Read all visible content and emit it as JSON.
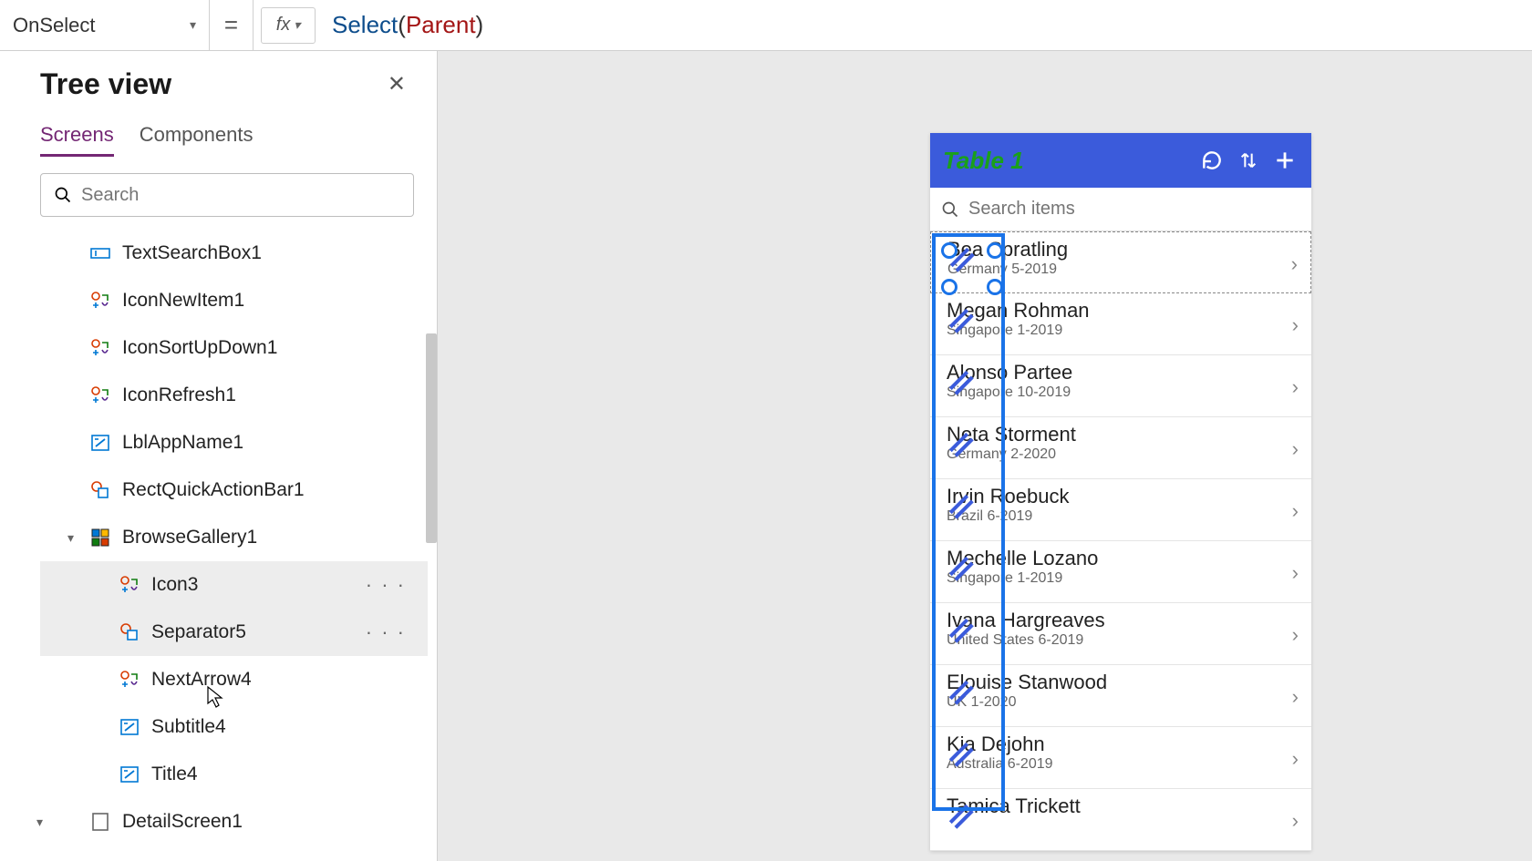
{
  "property_selector": "OnSelect",
  "formula": {
    "fn": "Select",
    "arg": "Parent"
  },
  "tree_view": {
    "title": "Tree view",
    "tabs": {
      "active": "Screens",
      "other": "Components"
    },
    "search_placeholder": "Search",
    "items": [
      {
        "label": "TextSearchBox1",
        "type": "textinput"
      },
      {
        "label": "IconNewItem1",
        "type": "icon"
      },
      {
        "label": "IconSortUpDown1",
        "type": "icon"
      },
      {
        "label": "IconRefresh1",
        "type": "icon"
      },
      {
        "label": "LblAppName1",
        "type": "label"
      },
      {
        "label": "RectQuickActionBar1",
        "type": "rect"
      },
      {
        "label": "BrowseGallery1",
        "type": "gallery",
        "expanded": true
      },
      {
        "label": "Icon3",
        "type": "icon",
        "child": true,
        "selected": true
      },
      {
        "label": "Separator5",
        "type": "rect",
        "child": true,
        "hover": true
      },
      {
        "label": "NextArrow4",
        "type": "icon",
        "child": true
      },
      {
        "label": "Subtitle4",
        "type": "label",
        "child": true
      },
      {
        "label": "Title4",
        "type": "label",
        "child": true
      },
      {
        "label": "DetailScreen1",
        "type": "screen",
        "expanded": true
      }
    ]
  },
  "app": {
    "title": "Table 1",
    "search_placeholder": "Search items",
    "rows": [
      {
        "name": "Bea Spratling",
        "sub": "Germany 5-2019"
      },
      {
        "name": "Megan Rohman",
        "sub": "Singapore 1-2019"
      },
      {
        "name": "Alonso Partee",
        "sub": "Singapore 10-2019"
      },
      {
        "name": "Neta Storment",
        "sub": "Germany 2-2020"
      },
      {
        "name": "Irvin Roebuck",
        "sub": "Brazil 6-2019"
      },
      {
        "name": "Mechelle Lozano",
        "sub": "Singapore 1-2019"
      },
      {
        "name": "Ivana Hargreaves",
        "sub": "United States 6-2019"
      },
      {
        "name": "Elouise Stanwood",
        "sub": "UK 1-2020"
      },
      {
        "name": "Kia Dejohn",
        "sub": "Australia 6-2019"
      },
      {
        "name": "Tamica Trickett",
        "sub": ""
      }
    ]
  }
}
